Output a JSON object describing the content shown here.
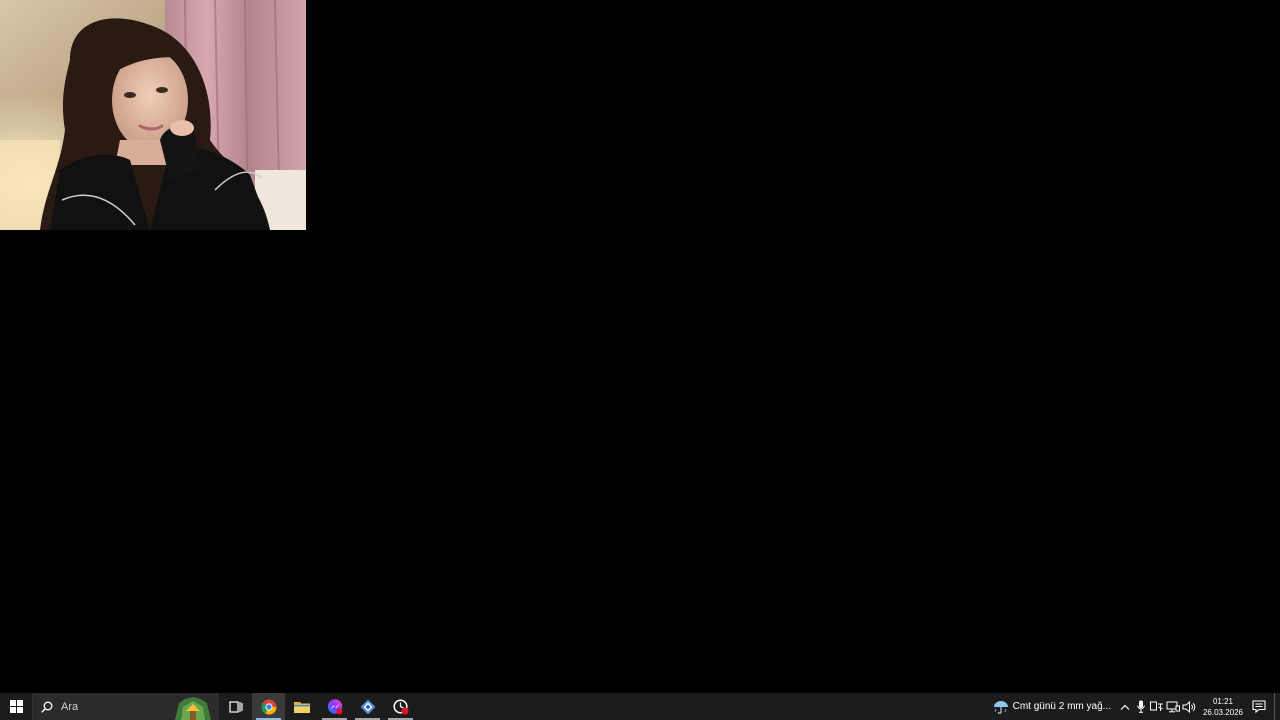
{
  "taskbar": {
    "search": {
      "placeholder": "Ara"
    },
    "pinned_apps": [
      {
        "name": "task-view",
        "icon": "task-view-icon"
      },
      {
        "name": "chrome",
        "icon": "chrome-icon",
        "state": "active"
      },
      {
        "name": "file-explorer",
        "icon": "folder-icon"
      },
      {
        "name": "messenger",
        "icon": "messenger-icon",
        "state": "running"
      },
      {
        "name": "app-blue",
        "icon": "app-diamond-icon",
        "state": "running"
      },
      {
        "name": "app-red",
        "icon": "app-circle-icon",
        "state": "running"
      }
    ],
    "weather": {
      "text": "Cmt günü 2 mm yağ...",
      "icon": "rain-umbrella-icon"
    },
    "clock": {
      "time": "01:21",
      "date": "26.03.2026"
    }
  },
  "colors": {
    "desktop": "#000000",
    "taskbar": "#1c1c1c",
    "accent": "#8fb8e8"
  }
}
